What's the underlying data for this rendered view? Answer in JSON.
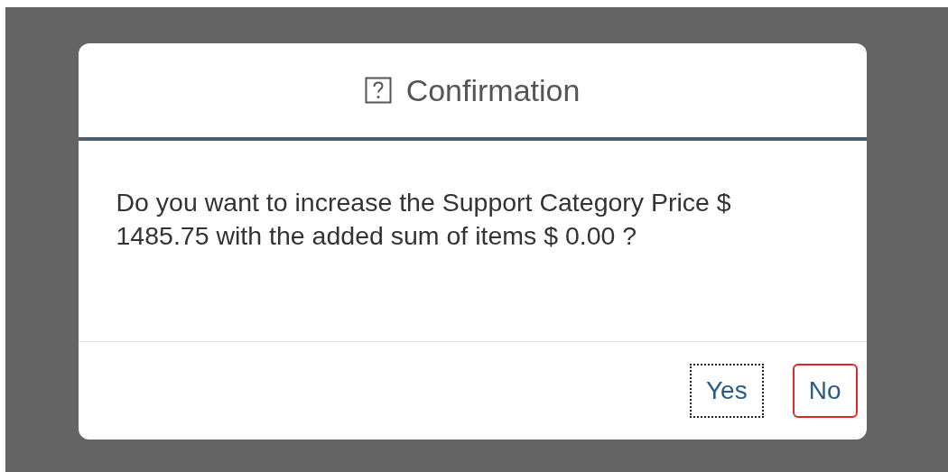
{
  "dialog": {
    "title": "Confirmation",
    "message": "Do you want to increase the Support Category Price $ 1485.75 with the added sum of items $ 0.00 ?",
    "buttons": [
      {
        "label": "Yes",
        "focused": true,
        "emphasized": false
      },
      {
        "label": "No",
        "focused": false,
        "emphasized": true
      }
    ]
  }
}
